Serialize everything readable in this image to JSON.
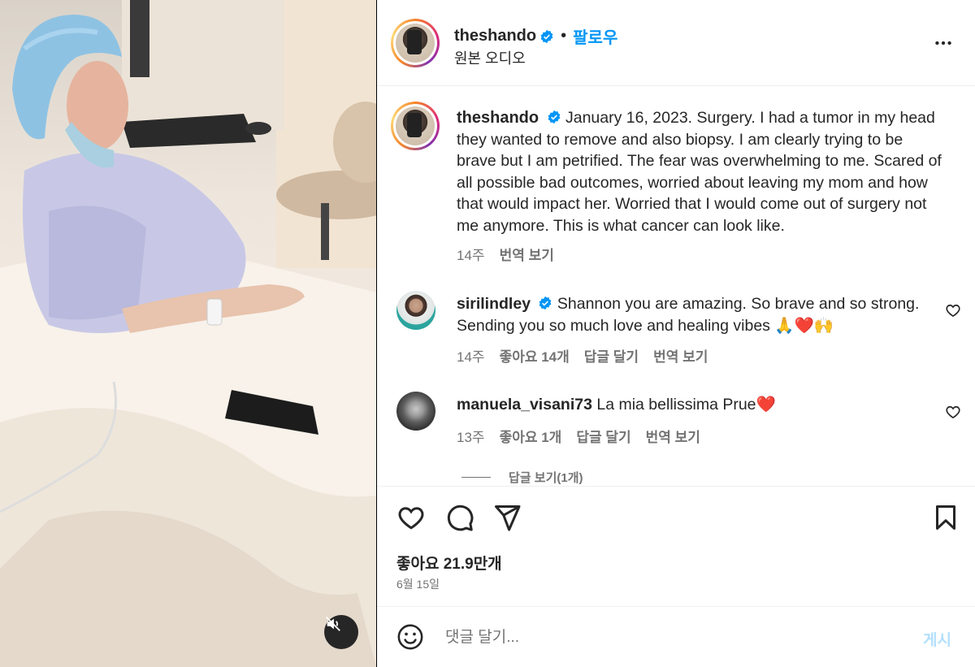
{
  "header": {
    "username": "theshando",
    "separator": "•",
    "follow_label": "팔로우",
    "audio_label": "원본 오디오"
  },
  "caption": {
    "username": "theshando",
    "text": "January 16, 2023. Surgery. I had a tumor in my head they wanted to remove and also biopsy. I am clearly trying to be brave but I am petrified. The fear was overwhelming to me. Scared of all possible bad outcomes, worried about leaving my mom and how that would impact her. Worried that I would come out of surgery not me anymore. This is what cancer can look like.",
    "time": "14주",
    "translate": "번역 보기"
  },
  "comments": [
    {
      "username": "sirilindley",
      "verified": true,
      "text": "Shannon you are amazing. So brave and so strong. Sending you so much love and healing vibes 🙏❤️🙌",
      "time": "14주",
      "likes": "좋아요 14개",
      "reply": "답글 달기",
      "translate": "번역 보기"
    },
    {
      "username": "manuela_visani73",
      "verified": false,
      "text": "La mia bellissima Prue❤️",
      "time": "13주",
      "likes": "좋아요 1개",
      "reply": "답글 달기",
      "translate": "번역 보기",
      "view_replies": "답글 보기(1개)"
    }
  ],
  "actions": {
    "like_icon": "heart-outline",
    "comment_icon": "speech-bubble",
    "share_icon": "paper-plane",
    "save_icon": "bookmark",
    "likes_count": "좋아요 21.9만개",
    "date": "6월 15일"
  },
  "composer": {
    "placeholder": "댓글 달기...",
    "post_label": "게시"
  },
  "colors": {
    "accent": "#0095f6",
    "muted": "#737373",
    "text": "#262626",
    "post_disabled": "#b2dffc"
  }
}
